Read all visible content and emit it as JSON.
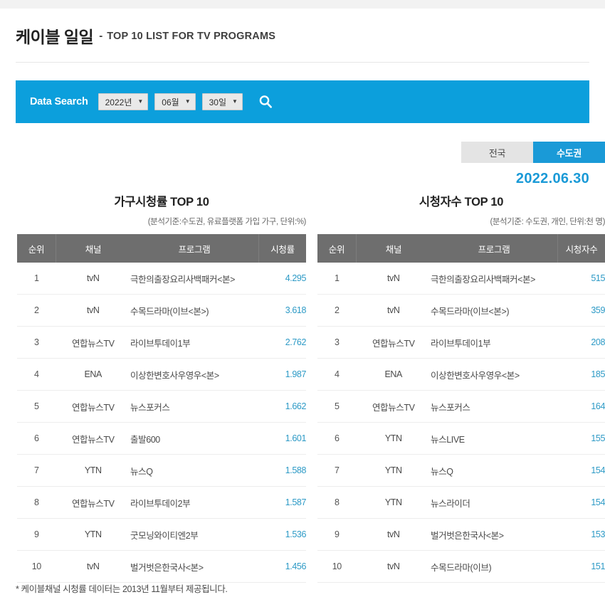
{
  "header": {
    "title_main": "케이블 일일",
    "title_dash": "-",
    "title_sub": "TOP 10 LIST FOR TV PROGRAMS"
  },
  "search": {
    "label": "Data Search",
    "year": "2022년",
    "month": "06월",
    "day": "30일",
    "caret": "▼",
    "search_icon_name": "search-icon",
    "band_color": "#0c9fdc"
  },
  "region_toggle": {
    "nationwide": "전국",
    "capital": "수도권",
    "active": "수도권",
    "active_color": "#1a9ad7",
    "inactive_color": "#e4e4e4"
  },
  "date": "2022.06.30",
  "accent_color": "#2d9ac6",
  "header_row_color": "#6e6e6e",
  "left_panel": {
    "title": "가구시청률 TOP 10",
    "subtitle": "(분석기준:수도권, 유료플랫폼 가입 가구, 단위:%)",
    "columns": [
      "순위",
      "채널",
      "프로그램",
      "시청률"
    ],
    "rows": [
      {
        "rank": "1",
        "channel": "tvN",
        "program": "극한의출장요리사백패커<본>",
        "value": "4.295"
      },
      {
        "rank": "2",
        "channel": "tvN",
        "program": "수목드라마(이브<본>)",
        "value": "3.618"
      },
      {
        "rank": "3",
        "channel": "연합뉴스TV",
        "program": "라이브투데이1부",
        "value": "2.762"
      },
      {
        "rank": "4",
        "channel": "ENA",
        "program": "이상한변호사우영우<본>",
        "value": "1.987"
      },
      {
        "rank": "5",
        "channel": "연합뉴스TV",
        "program": "뉴스포커스",
        "value": "1.662"
      },
      {
        "rank": "6",
        "channel": "연합뉴스TV",
        "program": "출발600",
        "value": "1.601"
      },
      {
        "rank": "7",
        "channel": "YTN",
        "program": "뉴스Q",
        "value": "1.588"
      },
      {
        "rank": "8",
        "channel": "연합뉴스TV",
        "program": "라이브투데이2부",
        "value": "1.587"
      },
      {
        "rank": "9",
        "channel": "YTN",
        "program": "굿모닝와이티엔2부",
        "value": "1.536"
      },
      {
        "rank": "10",
        "channel": "tvN",
        "program": "벌거벗은한국사<본>",
        "value": "1.456"
      }
    ]
  },
  "right_panel": {
    "title": "시청자수 TOP 10",
    "subtitle": "(분석기준: 수도권, 개인, 단위:천 명)",
    "columns": [
      "순위",
      "채널",
      "프로그램",
      "시청자수"
    ],
    "rows": [
      {
        "rank": "1",
        "channel": "tvN",
        "program": "극한의출장요리사백패커<본>",
        "value": "515"
      },
      {
        "rank": "2",
        "channel": "tvN",
        "program": "수목드라마(이브<본>)",
        "value": "359"
      },
      {
        "rank": "3",
        "channel": "연합뉴스TV",
        "program": "라이브투데이1부",
        "value": "208"
      },
      {
        "rank": "4",
        "channel": "ENA",
        "program": "이상한변호사우영우<본>",
        "value": "185"
      },
      {
        "rank": "5",
        "channel": "연합뉴스TV",
        "program": "뉴스포커스",
        "value": "164"
      },
      {
        "rank": "6",
        "channel": "YTN",
        "program": "뉴스LIVE",
        "value": "155"
      },
      {
        "rank": "7",
        "channel": "YTN",
        "program": "뉴스Q",
        "value": "154"
      },
      {
        "rank": "8",
        "channel": "YTN",
        "program": "뉴스라이더",
        "value": "154"
      },
      {
        "rank": "9",
        "channel": "tvN",
        "program": "벌거벗은한국사<본>",
        "value": "153"
      },
      {
        "rank": "10",
        "channel": "tvN",
        "program": "수목드라마(이브)",
        "value": "151"
      }
    ]
  },
  "footnote": "* 케이블채널 시청률 데이터는 2013년 11월부터 제공됩니다."
}
